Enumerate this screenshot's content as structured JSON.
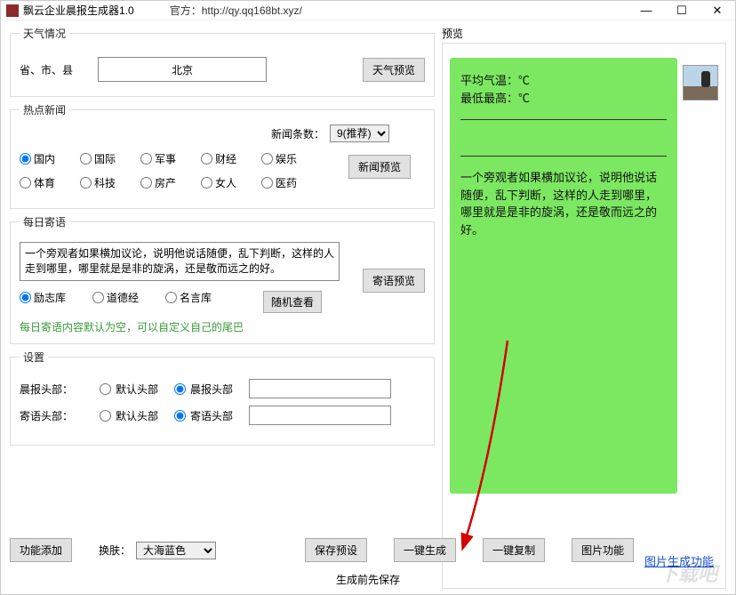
{
  "titlebar": {
    "title": "飘云企业晨报生成器1.0",
    "official_label": "官方：http://qy.qq168bt.xyz/"
  },
  "weather": {
    "legend": "天气情况",
    "location_label": "省、市、县",
    "location_value": "北京",
    "preview_btn": "天气预览"
  },
  "news": {
    "legend": "热点新闻",
    "count_label": "新闻条数：",
    "count_value": "9(推荐)",
    "preview_btn": "新闻预览",
    "categories": [
      "国内",
      "国际",
      "军事",
      "财经",
      "娱乐",
      "体育",
      "科技",
      "房产",
      "女人",
      "医药"
    ],
    "selected": "国内"
  },
  "jiyu": {
    "legend": "每日寄语",
    "text": "一个旁观者如果横加议论，说明他说话随便，乱下判断，这样的人走到哪里，哪里就是是非的旋涡，还是敬而远之的好。",
    "preview_btn": "寄语预览",
    "sources": [
      "励志库",
      "道德经",
      "名言库"
    ],
    "selected": "励志库",
    "random_btn": "随机查看",
    "hint": "每日寄语内容默认为空，可以自定义自己的尾巴"
  },
  "settings": {
    "legend": "设置",
    "morning_label": "晨报头部：",
    "morning_options": [
      "默认头部",
      "晨报头部"
    ],
    "morning_selected": "晨报头部",
    "morning_value": "",
    "jiyu_label": "寄语头部：",
    "jiyu_options": [
      "默认头部",
      "寄语头部"
    ],
    "jiyu_selected": "寄语头部",
    "jiyu_value": ""
  },
  "bottom": {
    "add_func": "功能添加",
    "skin_label": "换肤：",
    "skin_value": "大海蓝色",
    "save_preset": "保存预设",
    "generate": "一键生成",
    "copy": "一键复制",
    "image_func": "图片功能",
    "save_hint": "生成前先保存",
    "img_gen_link": "图片生成功能"
  },
  "preview": {
    "legend": "预览",
    "line1": "平均气温：℃",
    "line2": "最低最高：℃",
    "quote": "一个旁观者如果横加议论，说明他说话随便，乱下判断，这样的人走到哪里，哪里就是是非的旋涡，还是敬而远之的好。"
  },
  "watermark": "下载吧"
}
